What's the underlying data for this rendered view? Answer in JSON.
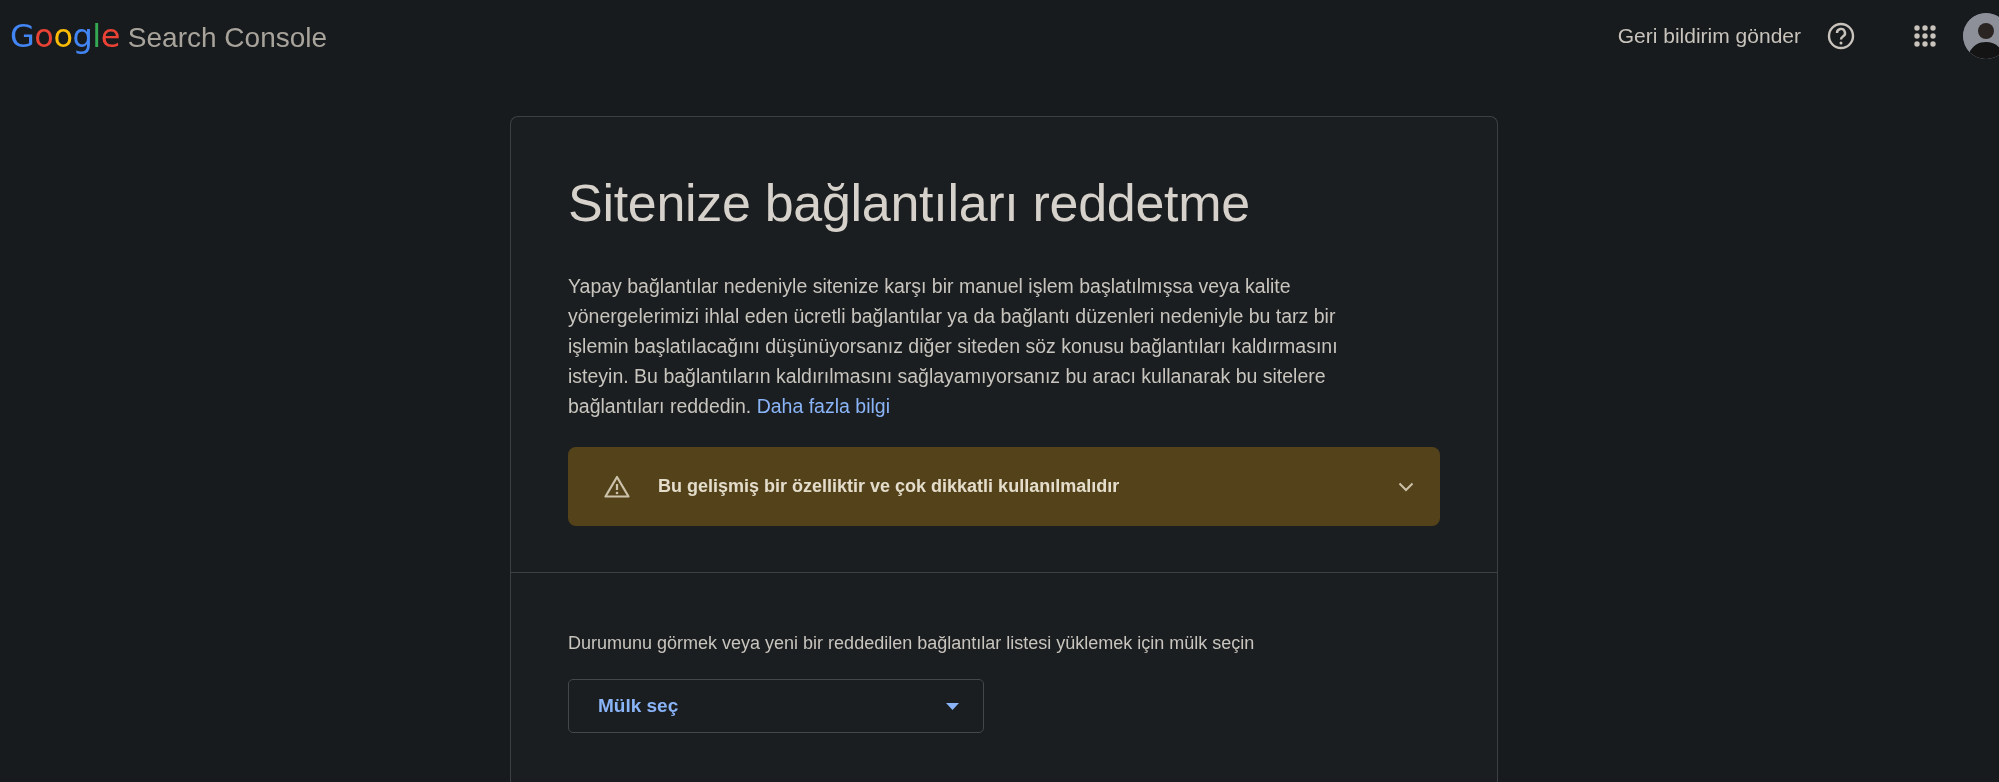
{
  "header": {
    "logo_letters": [
      {
        "char": "G",
        "color": "#4285f4"
      },
      {
        "char": "o",
        "color": "#ea4335"
      },
      {
        "char": "o",
        "color": "#fbbc05"
      },
      {
        "char": "g",
        "color": "#4285f4"
      },
      {
        "char": "l",
        "color": "#34a853"
      },
      {
        "char": "e",
        "color": "#ea4335"
      }
    ],
    "product_name": "Search Console",
    "feedback_link": "Geri bildirim gönder"
  },
  "card": {
    "title": "Sitenize bağlantıları reddetme",
    "description": "Yapay bağlantılar nedeniyle sitenize karşı bir manuel işlem başlatılmışsa veya kalite yönergelerimizi ihlal eden ücretli bağlantılar ya da bağlantı düzenleri nedeniyle bu tarz bir işlemin başlatılacağını düşünüyorsanız diğer siteden söz konusu bağlantıları kaldırmasını isteyin. Bu bağlantıların kaldırılmasını sağlayamıyorsanız bu aracı kullanarak bu sitelere bağlantıları reddedin.",
    "learn_more_link": "Daha fazla bilgi",
    "warning": {
      "text": "Bu gelişmiş bir özelliktir ve çok dikkatli kullanılmalıdır",
      "expanded": false
    },
    "property_prompt": "Durumunu görmek veya yeni bir reddedilen bağlantılar listesi yüklemek için mülk seçin",
    "property_select": {
      "label": "Mülk seç"
    }
  }
}
